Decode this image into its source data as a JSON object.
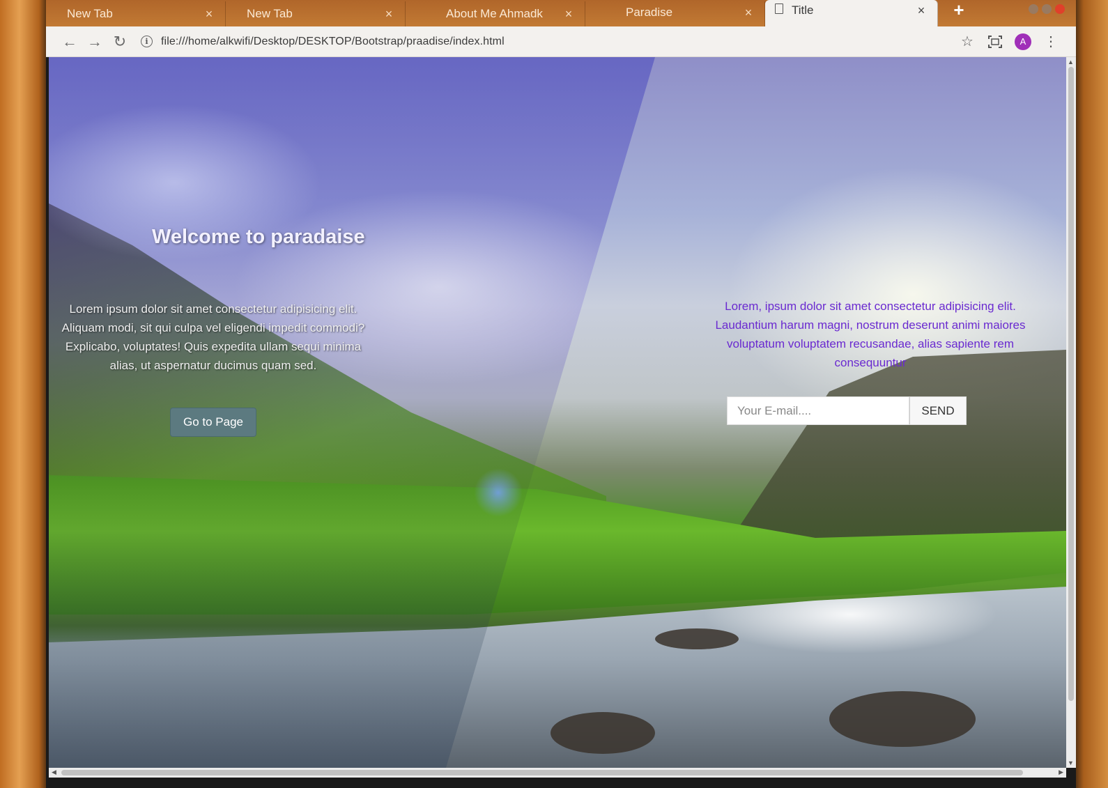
{
  "browser": {
    "tabs": [
      {
        "title": "New Tab",
        "close": "×"
      },
      {
        "title": "New Tab",
        "close": "×"
      },
      {
        "title": "About Me Ahmadk",
        "close": "×"
      },
      {
        "title": "Paradise",
        "close": "×"
      },
      {
        "title": "Title",
        "close": "×",
        "active": true
      }
    ],
    "new_tab_label": "+",
    "url": "file:///home/alkwifi/Desktop/DESKTOP/Bootstrap/praadise/index.html",
    "avatar_letter": "A"
  },
  "page": {
    "hero_title": "Welcome to paradaise",
    "hero_text": "Lorem ipsum dolor sit amet consectetur adipisicing elit. Aliquam modi, sit qui culpa vel eligendi impedit commodi? Explicabo, voluptates! Quis expedita ullam sequi minima alias, ut aspernatur ducimus quam sed.",
    "go_button": "Go to Page",
    "right_text": "Lorem, ipsum dolor sit amet consectetur adipisicing elit. Laudantium harum magni, nostrum deserunt animi maiores voluptatum voluptatem recusandae, alias sapiente rem consequuntur",
    "email_placeholder": "Your E-mail....",
    "send_button": "SEND"
  },
  "icons": {
    "back": "back-arrow-icon",
    "forward": "forward-arrow-icon",
    "reload": "reload-icon",
    "info": "info-icon",
    "bookmark": "star-icon",
    "screenshot": "capture-icon",
    "menu": "kebab-menu-icon"
  },
  "colors": {
    "accent_text": "#6a2ad0",
    "button_bg": "#5c7a80",
    "avatar": "#a02fb8"
  }
}
